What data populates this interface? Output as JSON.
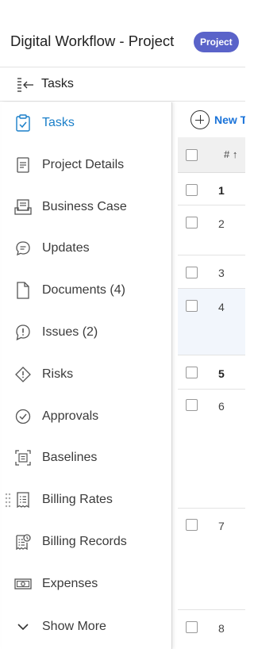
{
  "header": {
    "title": "Digital Workflow - Project",
    "badge": "Project"
  },
  "subheader": {
    "title": "Tasks"
  },
  "nav": {
    "items": [
      {
        "label": "Tasks",
        "icon": "task-clipboard-icon",
        "active": true
      },
      {
        "label": "Project Details",
        "icon": "document-lines-icon"
      },
      {
        "label": "Business Case",
        "icon": "business-case-icon"
      },
      {
        "label": "Updates",
        "icon": "chat-bubble-icon"
      },
      {
        "label": "Documents (4)",
        "icon": "file-icon"
      },
      {
        "label": "Issues (2)",
        "icon": "issue-bubble-icon"
      },
      {
        "label": "Risks",
        "icon": "risk-diamond-icon"
      },
      {
        "label": "Approvals",
        "icon": "check-circle-icon"
      },
      {
        "label": "Baselines",
        "icon": "baseline-icon"
      },
      {
        "label": "Billing Rates",
        "icon": "billing-rates-icon"
      },
      {
        "label": "Billing Records",
        "icon": "billing-records-icon"
      },
      {
        "label": "Expenses",
        "icon": "money-icon"
      },
      {
        "label": "Show More",
        "icon": "chevron-down-icon"
      }
    ]
  },
  "table": {
    "new_task_label": "New T",
    "column_num_header": "# ↑",
    "rows": [
      {
        "num": "1",
        "bold": true
      },
      {
        "num": "2"
      },
      {
        "num": "3"
      },
      {
        "num": "4",
        "highlight": true
      },
      {
        "num": "5",
        "bold": true
      },
      {
        "num": "6"
      },
      {
        "num": "7"
      },
      {
        "num": "8"
      }
    ]
  },
  "colors": {
    "accent": "#1a7fc9",
    "badge": "#5a63c9",
    "link": "#1a73d9"
  }
}
